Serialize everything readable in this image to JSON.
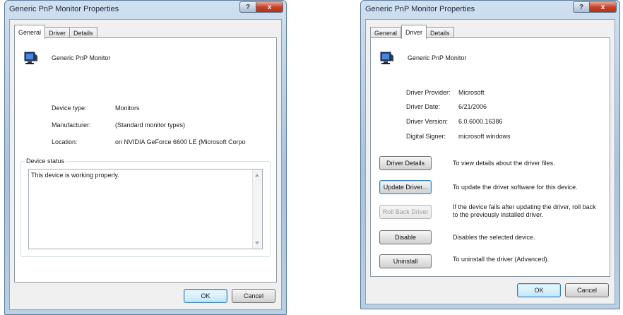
{
  "left_dialog": {
    "title": "Generic PnP Monitor Properties",
    "tabs": [
      "General",
      "Driver",
      "Details"
    ],
    "device_name": "Generic PnP Monitor",
    "props": [
      {
        "label": "Device type:",
        "value": "Monitors"
      },
      {
        "label": "Manufacturer:",
        "value": "(Standard monitor types)"
      },
      {
        "label": "Location:",
        "value": "on NVIDIA GeForce 6600 LE (Microsoft Corpo"
      }
    ],
    "status_group_title": "Device status",
    "status_text": "This device is working properly.",
    "ok_label": "OK",
    "cancel_label": "Cancel"
  },
  "right_dialog": {
    "title": "Generic PnP Monitor Properties",
    "tabs": [
      "General",
      "Driver",
      "Details"
    ],
    "device_name": "Generic PnP Monitor",
    "props": [
      {
        "label": "Driver Provider:",
        "value": "Microsoft"
      },
      {
        "label": "Driver Date:",
        "value": "6/21/2006"
      },
      {
        "label": "Driver Version:",
        "value": "6.0.6000.16386"
      },
      {
        "label": "Digital Signer:",
        "value": "microsoft windows"
      }
    ],
    "actions": [
      {
        "label": "Driver Details",
        "desc": "To view details about the driver files."
      },
      {
        "label": "Update Driver...",
        "desc": "To update the driver software for this device."
      },
      {
        "label": "Roll Back Driver",
        "desc": "If the device fails after updating the driver, roll back to the previously installed driver."
      },
      {
        "label": "Disable",
        "desc": "Disables the selected device."
      },
      {
        "label": "Uninstall",
        "desc": "To uninstall the driver (Advanced)."
      }
    ],
    "ok_label": "OK",
    "cancel_label": "Cancel"
  },
  "titlebar": {
    "help_label": "?",
    "close_label": "x"
  },
  "colors": {
    "accent": "#3c7fb1",
    "close_red": "#c7432a",
    "titlebar": "#a9c3dc"
  },
  "icons": {
    "device": "monitor-icon"
  }
}
